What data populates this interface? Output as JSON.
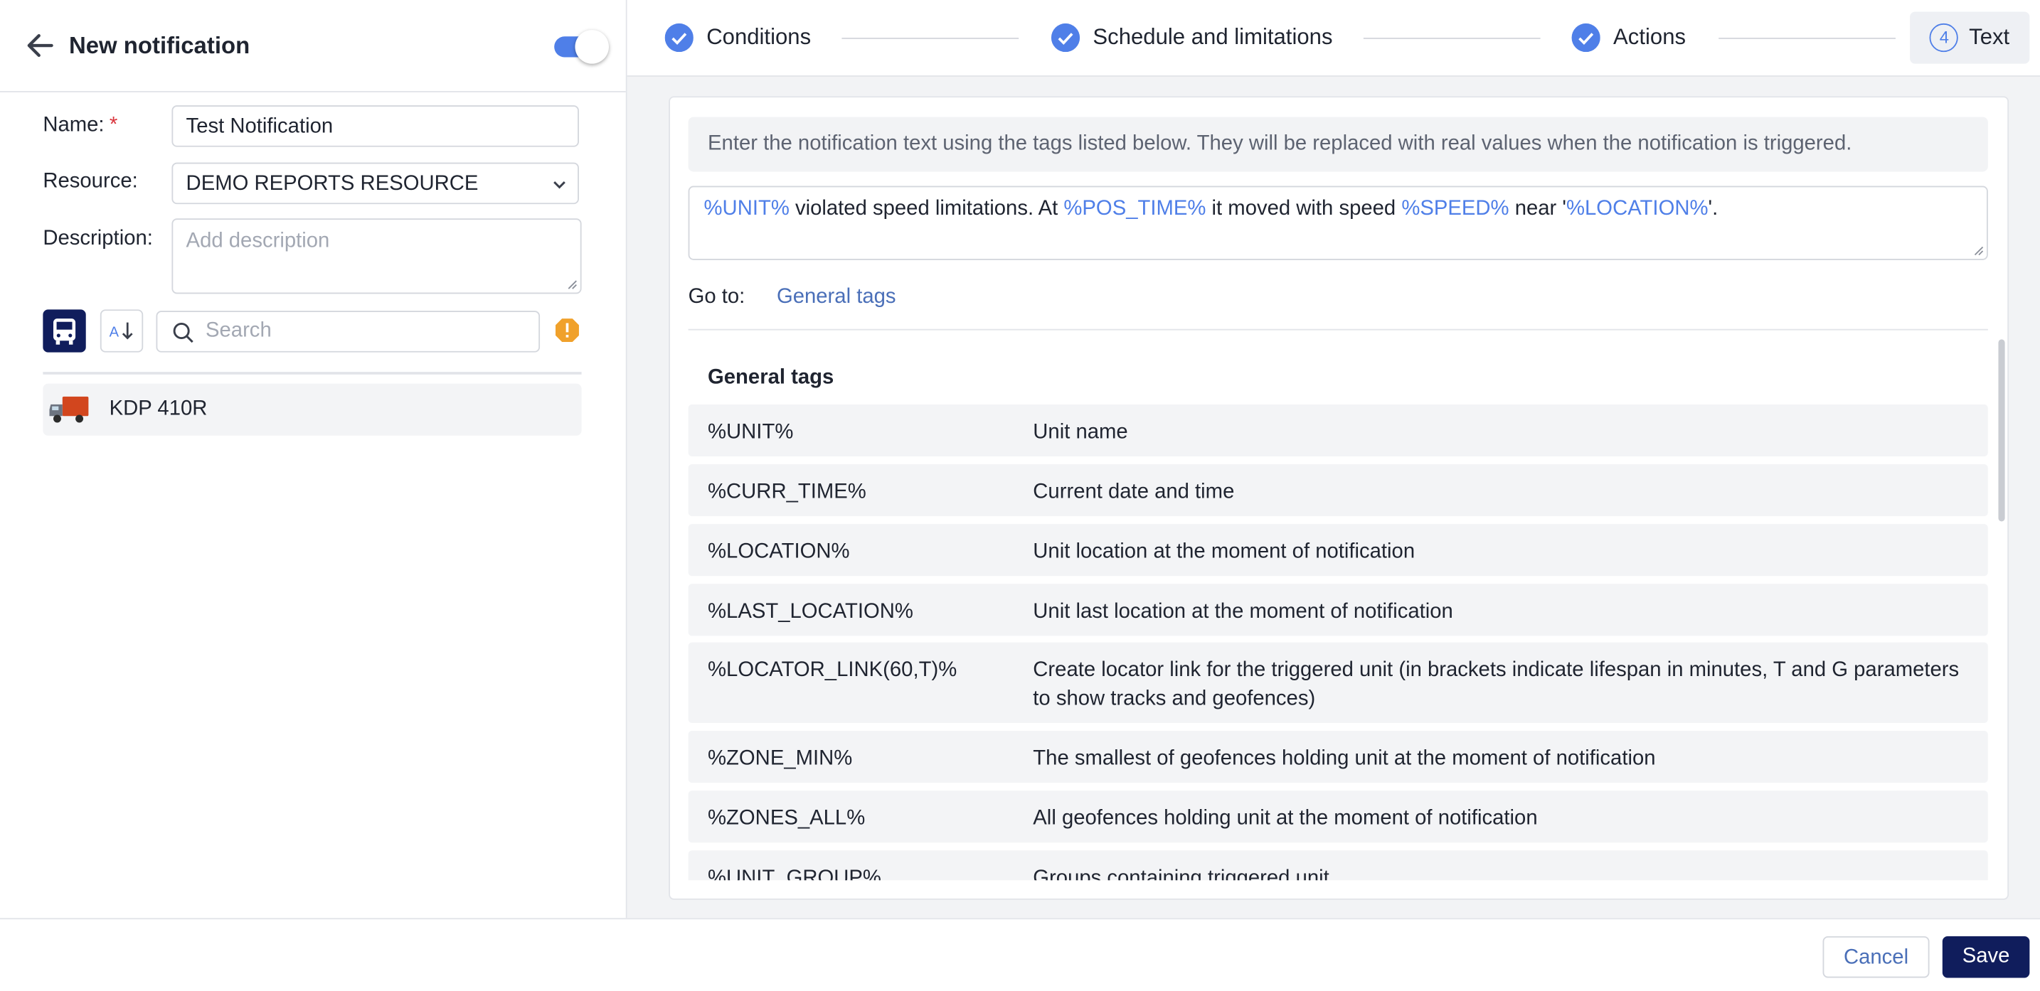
{
  "left_panel": {
    "title": "New notification",
    "enabled": true,
    "name_label": "Name:",
    "required_mark": "*",
    "name_value": "Test Notification",
    "resource_label": "Resource:",
    "resource_value": "DEMO REPORTS RESOURCE",
    "description_label": "Description:",
    "description_placeholder": "Add description",
    "search_placeholder": "Search",
    "sort_label": "A",
    "units": [
      {
        "name": "KDP 410R",
        "icon": "truck-icon"
      }
    ]
  },
  "steps": [
    {
      "label": "Conditions",
      "state": "done"
    },
    {
      "label": "Schedule and limitations",
      "state": "done"
    },
    {
      "label": "Actions",
      "state": "done"
    },
    {
      "label": "Text",
      "number": "4",
      "state": "active"
    }
  ],
  "text_step": {
    "hint": "Enter the notification text using the tags listed below. They will be replaced with real values when the notification is triggered.",
    "message": [
      {
        "text": "%UNIT%",
        "tag": true
      },
      {
        "text": " violated speed limitations. At ",
        "tag": false
      },
      {
        "text": "%POS_TIME%",
        "tag": true
      },
      {
        "text": " it moved with speed ",
        "tag": false
      },
      {
        "text": "%SPEED%",
        "tag": true
      },
      {
        "text": " near '",
        "tag": false
      },
      {
        "text": "%LOCATION%",
        "tag": true
      },
      {
        "text": "'.",
        "tag": false
      }
    ],
    "goto_label": "Go to:",
    "goto_link": "General tags",
    "section_title": "General tags",
    "tags": [
      {
        "name": "%UNIT%",
        "desc": "Unit name"
      },
      {
        "name": "%CURR_TIME%",
        "desc": "Current date and time"
      },
      {
        "name": "%LOCATION%",
        "desc": "Unit location at the moment of notification"
      },
      {
        "name": "%LAST_LOCATION%",
        "desc": "Unit last location at the moment of notification"
      },
      {
        "name": "%LOCATOR_LINK(60,T)%",
        "desc": "Create locator link for the triggered unit (in brackets indicate lifespan in minutes, T and G parameters to show tracks and geofences)"
      },
      {
        "name": "%ZONE_MIN%",
        "desc": "The smallest of geofences holding unit at the moment of notification"
      },
      {
        "name": "%ZONES_ALL%",
        "desc": "All geofences holding unit at the moment of notification"
      },
      {
        "name": "%UNIT_GROUP%",
        "desc": "Groups containing triggered unit"
      }
    ]
  },
  "footer": {
    "cancel_label": "Cancel",
    "save_label": "Save"
  },
  "colors": {
    "accent": "#4f7fe8",
    "primary": "#101d5c",
    "link": "#4a6fb8",
    "warning": "#f0a12b"
  }
}
